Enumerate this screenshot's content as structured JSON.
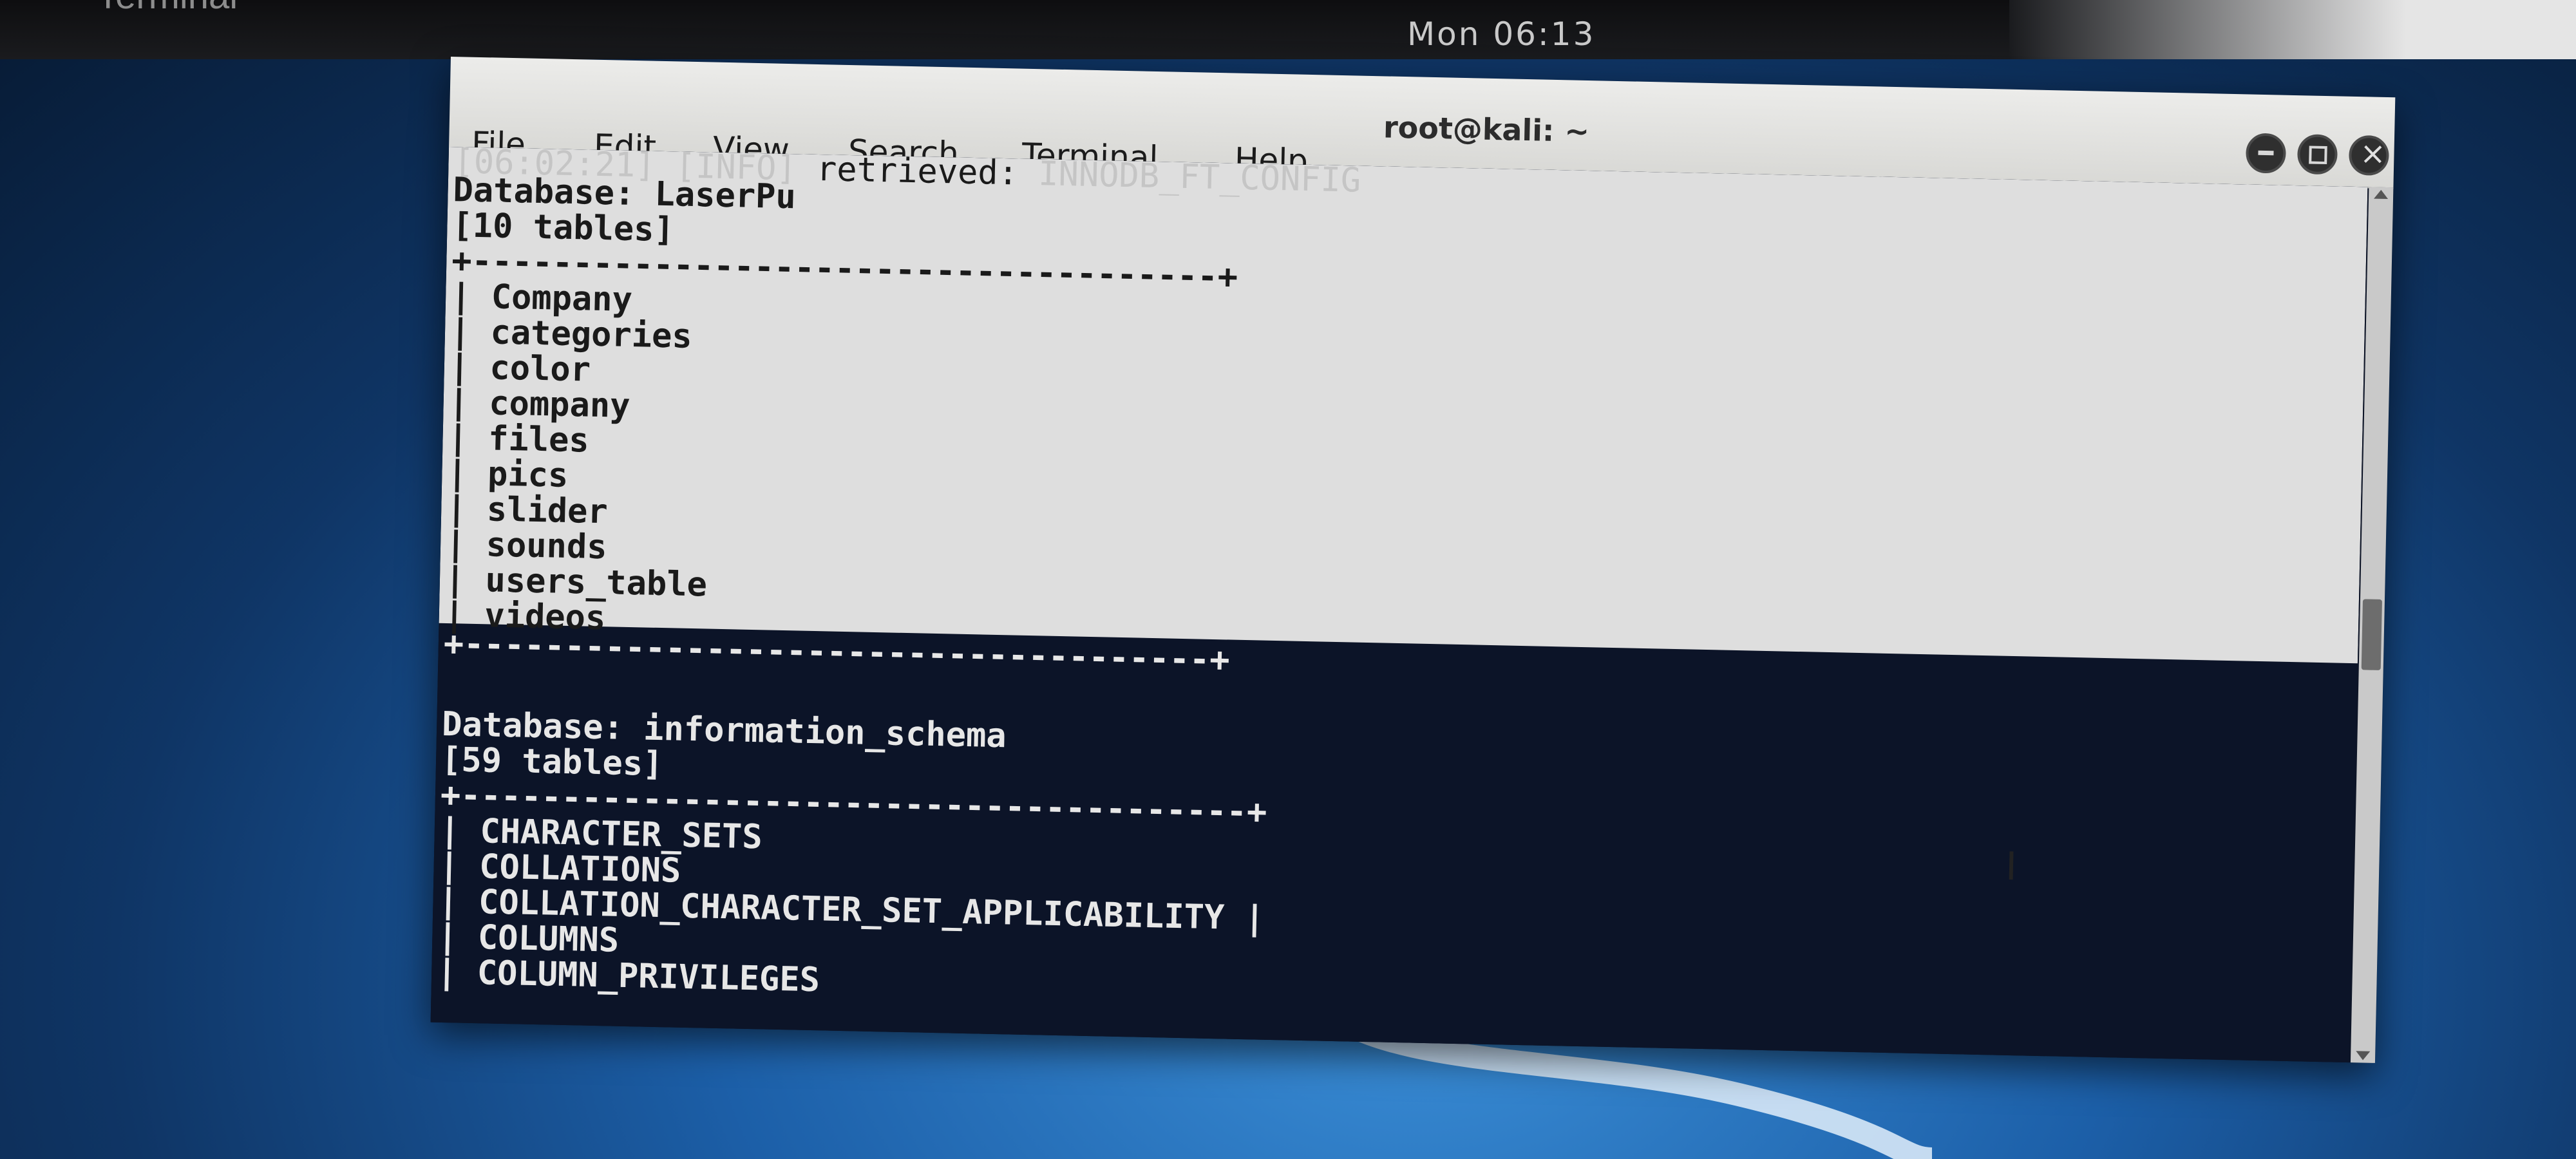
{
  "desktop": {
    "taskbar_app": "Terminal",
    "clock": "Mon 06:13"
  },
  "window": {
    "title": "root@kali: ~",
    "menu": [
      "File",
      "Edit",
      "View",
      "Search",
      "Terminal",
      "Help"
    ]
  },
  "terminal": {
    "log_time": "[06:02:21]",
    "log_level": "[INFO]",
    "log_text": "retrieved:",
    "log_value": "INNODB_FT_CONFIG",
    "db1": {
      "header": "Database: LaserPu",
      "count": "[10 tables]",
      "border_top": "+-------------------------------------+",
      "tables": [
        "Company",
        "categories",
        "color",
        "company",
        "files",
        "pics",
        "slider",
        "sounds",
        "users_table",
        "videos"
      ],
      "border_bottom": "+-------------------------------------+"
    },
    "db2": {
      "header": "Database: information_schema",
      "count": "[59 tables]",
      "border_top": "+---------------------------------------+",
      "tables": [
        "CHARACTER_SETS",
        "COLLATIONS",
        "COLLATION_CHARACTER_SET_APPLICABILITY",
        "COLUMNS",
        "COLUMN_PRIVILEGES"
      ]
    }
  }
}
